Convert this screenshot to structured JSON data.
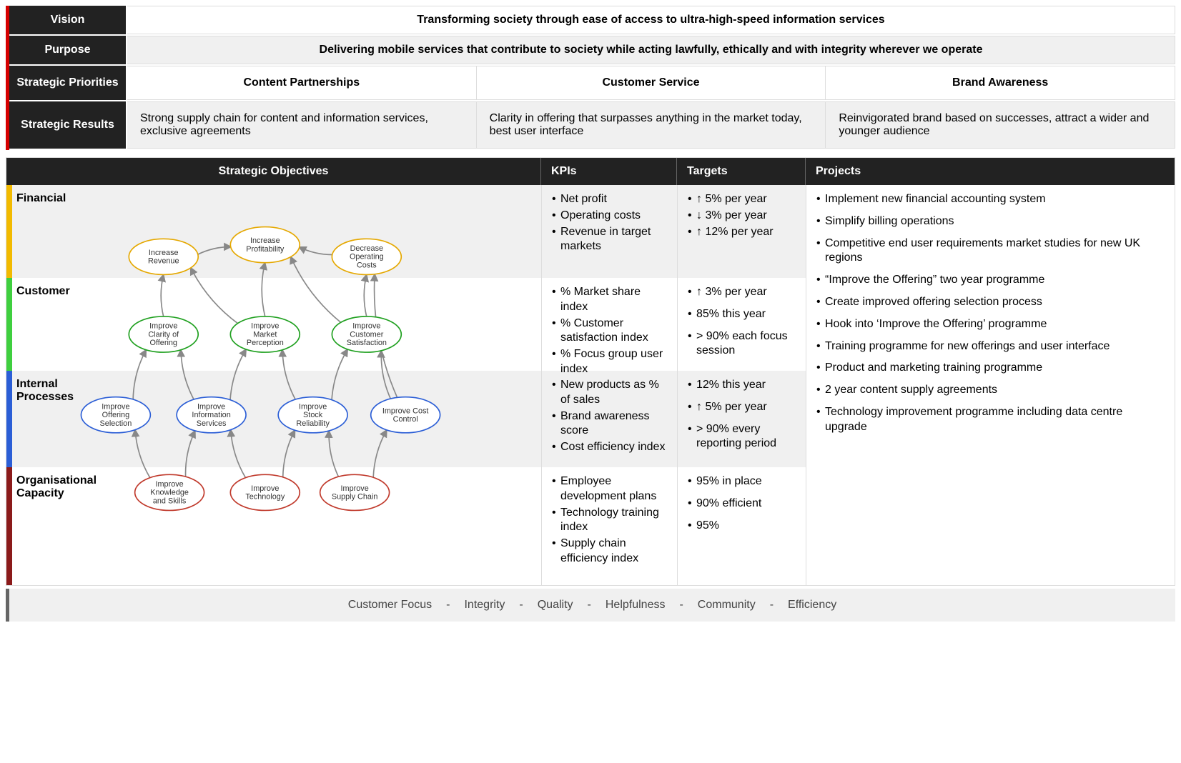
{
  "top": {
    "vision_label": "Vision",
    "vision_text": "Transforming society through ease of access to ultra-high-speed information services",
    "purpose_label": "Purpose",
    "purpose_text": "Delivering mobile services that contribute to society while acting lawfully, ethically and with integrity wherever we operate",
    "sp_label": "Strategic Priorities",
    "sp": [
      "Content Partnerships",
      "Customer Service",
      "Brand Awareness"
    ],
    "sr_label": "Strategic Results",
    "sr": [
      "Strong supply chain for content and information services, exclusive agreements",
      "Clarity in offering that surpasses anything in the market today, best user interface",
      "Reinvigorated brand based on successes, attract a wider and younger audience"
    ]
  },
  "headers": {
    "objectives": "Strategic Objectives",
    "kpis": "KPIs",
    "targets": "Targets",
    "projects": "Projects"
  },
  "perspectives": {
    "financial": {
      "label": "Financial",
      "objectives": [
        "Increase Revenue",
        "Increase Profitability",
        "Decrease Operating Costs"
      ],
      "kpis": [
        "Net profit",
        "Operating costs",
        "Revenue in target markets"
      ],
      "targets": [
        "↑ 5% per year",
        "↓ 3% per year",
        "↑ 12% per year"
      ]
    },
    "customer": {
      "label": "Customer",
      "objectives": [
        "Improve Clarity of Offering",
        "Improve Market Perception",
        "Improve Customer Satisfaction"
      ],
      "kpis": [
        "% Market share index",
        "% Customer satisfaction index",
        "% Focus group user index"
      ],
      "targets": [
        "↑ 3% per year",
        "85% this year",
        "> 90% each focus session"
      ]
    },
    "internal": {
      "label": "Internal Processes",
      "objectives": [
        "Improve Offering Selection",
        "Improve Information Services",
        "Improve Stock Reliability",
        "Improve Cost Control"
      ],
      "kpis": [
        "New products as % of sales",
        "Brand awareness score",
        "Cost efficiency index"
      ],
      "targets": [
        "12% this year",
        "↑ 5% per year",
        "> 90% every reporting period"
      ]
    },
    "org": {
      "label": "Organisational Capacity",
      "objectives": [
        "Improve Knowledge and Skills",
        "Improve Technology",
        "Improve Supply Chain"
      ],
      "kpis": [
        "Employee development plans",
        "Technology training index",
        "Supply chain efficiency index"
      ],
      "targets": [
        "95% in place",
        "90% efficient",
        "95%"
      ]
    }
  },
  "projects": [
    "Implement new financial accounting system",
    "Simplify billing operations",
    "Competitive end user requirements market studies for new UK regions",
    "“Improve the Offering” two year programme",
    "Create improved offering selection process",
    "Hook into ‘Improve the Offering’ programme",
    "Training programme for new offerings and user interface",
    "Product and marketing training programme",
    "2 year content supply agreements",
    "Technology improvement programme including data centre upgrade"
  ],
  "values": [
    "Customer Focus",
    "Integrity",
    "Quality",
    "Helpfulness",
    "Community",
    "Efficiency"
  ],
  "chart_data": {
    "type": "strategy-map",
    "nodes": [
      {
        "id": "rev",
        "label": "Increase Revenue",
        "perspective": "financial"
      },
      {
        "id": "prof",
        "label": "Increase Profitability",
        "perspective": "financial"
      },
      {
        "id": "cost",
        "label": "Decrease Operating Costs",
        "perspective": "financial"
      },
      {
        "id": "clarity",
        "label": "Improve Clarity of Offering",
        "perspective": "customer"
      },
      {
        "id": "percep",
        "label": "Improve Market Perception",
        "perspective": "customer"
      },
      {
        "id": "sat",
        "label": "Improve Customer Satisfaction",
        "perspective": "customer"
      },
      {
        "id": "offsel",
        "label": "Improve Offering Selection",
        "perspective": "internal"
      },
      {
        "id": "info",
        "label": "Improve Information Services",
        "perspective": "internal"
      },
      {
        "id": "stock",
        "label": "Improve Stock Reliability",
        "perspective": "internal"
      },
      {
        "id": "costctl",
        "label": "Improve Cost Control",
        "perspective": "internal"
      },
      {
        "id": "know",
        "label": "Improve Knowledge and Skills",
        "perspective": "org"
      },
      {
        "id": "tech",
        "label": "Improve Technology",
        "perspective": "org"
      },
      {
        "id": "supply",
        "label": "Improve Supply Chain",
        "perspective": "org"
      }
    ],
    "edges": [
      [
        "rev",
        "prof"
      ],
      [
        "cost",
        "prof"
      ],
      [
        "clarity",
        "rev"
      ],
      [
        "percep",
        "rev"
      ],
      [
        "percep",
        "prof"
      ],
      [
        "sat",
        "prof"
      ],
      [
        "sat",
        "cost"
      ],
      [
        "offsel",
        "clarity"
      ],
      [
        "info",
        "clarity"
      ],
      [
        "info",
        "percep"
      ],
      [
        "stock",
        "percep"
      ],
      [
        "stock",
        "sat"
      ],
      [
        "costctl",
        "sat"
      ],
      [
        "costctl",
        "cost"
      ],
      [
        "know",
        "offsel"
      ],
      [
        "know",
        "info"
      ],
      [
        "tech",
        "info"
      ],
      [
        "tech",
        "stock"
      ],
      [
        "supply",
        "stock"
      ],
      [
        "supply",
        "costctl"
      ]
    ]
  }
}
